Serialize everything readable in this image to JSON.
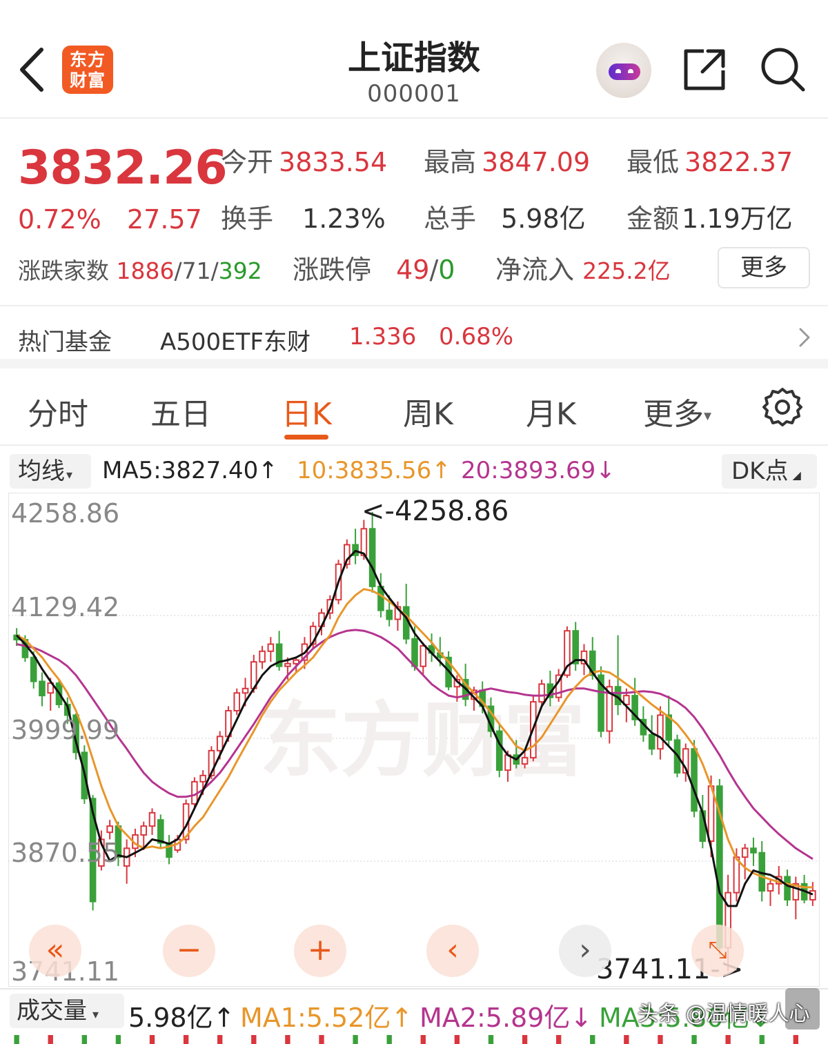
{
  "header": {
    "brand_line1": "东方",
    "brand_line2": "财富",
    "title": "上证指数",
    "code": "000001"
  },
  "quote": {
    "price": "3832.26",
    "change_pct": "0.72%",
    "change_abs": "27.57",
    "open_label": "今开",
    "open_value": "3833.54",
    "high_label": "最高",
    "high_value": "3847.09",
    "low_label": "最低",
    "low_value": "3822.37",
    "turnover_label": "换手",
    "turnover_value": "1.23%",
    "volume_label": "总手",
    "volume_value": "5.98亿",
    "amount_label": "金额",
    "amount_value": "1.19万亿",
    "breadth_label": "涨跌家数",
    "breadth_up": "1886",
    "breadth_sep1": "/",
    "breadth_flat": "71",
    "breadth_sep2": "/",
    "breadth_down": "392",
    "limit_label": "涨跌停",
    "limit_up": "49",
    "limit_sep": "/",
    "limit_down": "0",
    "inflow_label": "净流入",
    "inflow_value": "225.2亿",
    "more_label": "更多"
  },
  "fund": {
    "label": "热门基金",
    "name": "A500ETF东财",
    "price": "1.336",
    "pct": "0.68%"
  },
  "tabs": [
    "分时",
    "五日",
    "日K",
    "周K",
    "月K",
    "更多"
  ],
  "active_tab": "日K",
  "ma": {
    "select_label": "均线",
    "ma5": "MA5:3827.40↑",
    "ma10": "10:3835.56↑",
    "ma20": "20:3893.69↓",
    "dk_label": "DK点"
  },
  "chart_axis": {
    "y1": "4258.86",
    "y2": "4129.42",
    "y3": "3999.99",
    "y4": "3870.55",
    "y5": "3741.11",
    "max_marker": "<-4258.86",
    "min_marker": "3741.11->"
  },
  "controls": [
    "«",
    "−",
    "+",
    "‹",
    "›"
  ],
  "watermark": "东方财富",
  "volume": {
    "select_label": "成交量",
    "value": "5.98亿↑",
    "ma1": "MA1:5.52亿↑",
    "ma2": "MA2:5.89亿↓",
    "ma3": "MA3:5.80亿↓"
  },
  "credit": "头条 @温情暖人心",
  "colors": {
    "up": "#d9363e",
    "down": "#3aa13a",
    "ma5": "#111111",
    "ma10": "#e8962a",
    "ma20": "#b5348f",
    "accent": "#e8591a"
  },
  "chart_data": {
    "type": "candlestick",
    "ylim": [
      3741.11,
      4258.86
    ],
    "ohlc": [
      [
        4120,
        4128,
        4108,
        4115
      ],
      [
        4115,
        4120,
        4090,
        4095
      ],
      [
        4095,
        4102,
        4060,
        4068
      ],
      [
        4068,
        4078,
        4040,
        4052
      ],
      [
        4055,
        4072,
        4035,
        4066
      ],
      [
        4066,
        4070,
        4038,
        4042
      ],
      [
        4042,
        4050,
        4020,
        4030
      ],
      [
        4030,
        4032,
        3980,
        3988
      ],
      [
        3988,
        3996,
        3930,
        3936
      ],
      [
        3936,
        3940,
        3810,
        3820
      ],
      [
        3860,
        3900,
        3855,
        3890
      ],
      [
        3898,
        3912,
        3890,
        3905
      ],
      [
        3905,
        3910,
        3860,
        3870
      ],
      [
        3860,
        3890,
        3840,
        3880
      ],
      [
        3880,
        3902,
        3870,
        3895
      ],
      [
        3895,
        3910,
        3878,
        3905
      ],
      [
        3905,
        3925,
        3895,
        3920
      ],
      [
        3912,
        3918,
        3880,
        3886
      ],
      [
        3886,
        3895,
        3862,
        3870
      ],
      [
        3878,
        3895,
        3875,
        3890
      ],
      [
        3890,
        3935,
        3885,
        3930
      ],
      [
        3930,
        3960,
        3925,
        3955
      ],
      [
        3955,
        3968,
        3940,
        3962
      ],
      [
        3962,
        3995,
        3958,
        3990
      ],
      [
        3990,
        4012,
        3980,
        4006
      ],
      [
        4006,
        4040,
        4000,
        4035
      ],
      [
        4035,
        4060,
        4030,
        4055
      ],
      [
        4055,
        4072,
        4040,
        4060
      ],
      [
        4060,
        4098,
        4055,
        4090
      ],
      [
        4090,
        4108,
        4082,
        4102
      ],
      [
        4102,
        4118,
        4090,
        4110
      ],
      [
        4110,
        4125,
        4080,
        4085
      ],
      [
        4085,
        4095,
        4070,
        4088
      ],
      [
        4088,
        4096,
        4078,
        4092
      ],
      [
        4092,
        4118,
        4082,
        4110
      ],
      [
        4110,
        4135,
        4105,
        4130
      ],
      [
        4130,
        4150,
        4120,
        4145
      ],
      [
        4145,
        4165,
        4138,
        4160
      ],
      [
        4160,
        4205,
        4155,
        4200
      ],
      [
        4200,
        4228,
        4195,
        4222
      ],
      [
        4222,
        4240,
        4200,
        4210
      ],
      [
        4210,
        4250,
        4205,
        4240
      ],
      [
        4240,
        4259,
        4168,
        4175
      ],
      [
        4175,
        4190,
        4140,
        4148
      ],
      [
        4148,
        4165,
        4130,
        4138
      ],
      [
        4138,
        4158,
        4125,
        4152
      ],
      [
        4152,
        4178,
        4110,
        4116
      ],
      [
        4116,
        4130,
        4080,
        4085
      ],
      [
        4085,
        4112,
        4075,
        4108
      ],
      [
        4108,
        4122,
        4090,
        4100
      ],
      [
        4100,
        4118,
        4085,
        4095
      ],
      [
        4095,
        4102,
        4058,
        4062
      ],
      [
        4062,
        4075,
        4045,
        4070
      ],
      [
        4070,
        4088,
        4040,
        4048
      ],
      [
        4048,
        4062,
        4035,
        4058
      ],
      [
        4058,
        4068,
        4032,
        4040
      ],
      [
        4040,
        4050,
        4005,
        4012
      ],
      [
        4012,
        4020,
        3960,
        3968
      ],
      [
        3968,
        3990,
        3955,
        3985
      ],
      [
        3985,
        4002,
        3970,
        3975
      ],
      [
        3975,
        3990,
        3970,
        3982
      ],
      [
        3982,
        4052,
        3978,
        4045
      ],
      [
        4045,
        4070,
        4040,
        4065
      ],
      [
        4065,
        4080,
        4040,
        4050
      ],
      [
        4050,
        4082,
        4045,
        4075
      ],
      [
        4075,
        4130,
        4072,
        4125
      ],
      [
        4125,
        4135,
        4080,
        4088
      ],
      [
        4088,
        4110,
        4075,
        4102
      ],
      [
        4102,
        4118,
        4070,
        4075
      ],
      [
        4075,
        4085,
        4005,
        4012
      ],
      [
        4012,
        4070,
        3998,
        4062
      ],
      [
        4062,
        4120,
        4030,
        4042
      ],
      [
        4042,
        4060,
        4022,
        4052
      ],
      [
        4052,
        4072,
        4018,
        4025
      ],
      [
        4025,
        4040,
        4000,
        4008
      ],
      [
        4008,
        4030,
        3985,
        3992
      ],
      [
        3992,
        4040,
        3980,
        4030
      ],
      [
        4030,
        4052,
        3995,
        4002
      ],
      [
        4002,
        4008,
        3960,
        3965
      ],
      [
        3965,
        3998,
        3955,
        3992
      ],
      [
        3992,
        4002,
        3915,
        3922
      ],
      [
        3922,
        3940,
        3880,
        3888
      ],
      [
        3888,
        3962,
        3870,
        3950
      ],
      [
        3950,
        3958,
        3760,
        3768
      ],
      [
        3768,
        3850,
        3741,
        3830
      ],
      [
        3830,
        3880,
        3820,
        3870
      ],
      [
        3870,
        3885,
        3845,
        3880
      ],
      [
        3880,
        3892,
        3860,
        3875
      ],
      [
        3875,
        3888,
        3820,
        3832
      ],
      [
        3832,
        3845,
        3815,
        3840
      ],
      [
        3840,
        3860,
        3828,
        3848
      ],
      [
        3848,
        3856,
        3815,
        3822
      ],
      [
        3822,
        3848,
        3800,
        3840
      ],
      [
        3840,
        3850,
        3818,
        3822
      ],
      [
        3822,
        3842,
        3815,
        3832
      ]
    ],
    "ma5": [
      4120,
      4110,
      4098,
      4082,
      4068,
      4055,
      4040,
      4000,
      3965,
      3920,
      3885,
      3866,
      3872,
      3870,
      3875,
      3880,
      3890,
      3888,
      3885,
      3890,
      3905,
      3925,
      3945,
      3965,
      3985,
      4005,
      4025,
      4045,
      4060,
      4075,
      4085,
      4090,
      4092,
      4095,
      4100,
      4112,
      4130,
      4150,
      4180,
      4205,
      4215,
      4212,
      4196,
      4175,
      4162,
      4150,
      4140,
      4122,
      4110,
      4100,
      4090,
      4080,
      4068,
      4060,
      4050,
      4040,
      4018,
      3998,
      3985,
      3980,
      3990,
      4015,
      4040,
      4055,
      4068,
      4085,
      4092,
      4092,
      4078,
      4065,
      4055,
      4050,
      4040,
      4030,
      4020,
      4010,
      4005,
      3995,
      3985,
      3970,
      3945,
      3920,
      3880,
      3830,
      3815,
      3815,
      3840,
      3855,
      3852,
      3850,
      3845,
      3838,
      3835,
      3832,
      3828
    ],
    "ma10": [
      4120,
      4115,
      4105,
      4095,
      4082,
      4070,
      4055,
      4035,
      4010,
      3980,
      3950,
      3925,
      3905,
      3895,
      3885,
      3880,
      3882,
      3880,
      3882,
      3885,
      3893,
      3905,
      3915,
      3930,
      3945,
      3960,
      3978,
      3995,
      4012,
      4030,
      4045,
      4058,
      4068,
      4078,
      4086,
      4095,
      4108,
      4120,
      4140,
      4155,
      4165,
      4172,
      4170,
      4165,
      4158,
      4150,
      4142,
      4132,
      4122,
      4112,
      4100,
      4090,
      4078,
      4065,
      4055,
      4045,
      4033,
      4020,
      4008,
      3995,
      3990,
      3995,
      4005,
      4020,
      4035,
      4050,
      4062,
      4072,
      4078,
      4080,
      4078,
      4072,
      4065,
      4058,
      4050,
      4042,
      4035,
      4028,
      4020,
      4008,
      3995,
      3975,
      3950,
      3920,
      3890,
      3868,
      3858,
      3852,
      3848,
      3845,
      3842,
      3840,
      3838,
      3836,
      3836
    ],
    "ma20": [
      4110,
      4108,
      4106,
      4102,
      4097,
      4092,
      4085,
      4075,
      4062,
      4048,
      4034,
      4020,
      4005,
      3992,
      3978,
      3965,
      3955,
      3948,
      3942,
      3938,
      3938,
      3940,
      3946,
      3955,
      3965,
      3978,
      3992,
      4006,
      4020,
      4035,
      4050,
      4062,
      4075,
      4085,
      4095,
      4105,
      4112,
      4118,
      4122,
      4125,
      4126,
      4125,
      4122,
      4118,
      4112,
      4105,
      4095,
      4085,
      4075,
      4065,
      4058,
      4052,
      4050,
      4052,
      4055,
      4058,
      4060,
      4058,
      4056,
      4055,
      4053,
      4052,
      4052,
      4053,
      4055,
      4058,
      4060,
      4060,
      4058,
      4056,
      4055,
      4055,
      4055,
      4056,
      4057,
      4056,
      4054,
      4050,
      4045,
      4038,
      4028,
      4015,
      4000,
      3985,
      3968,
      3952,
      3938,
      3925,
      3915,
      3905,
      3896,
      3888,
      3880,
      3874,
      3868
    ]
  }
}
